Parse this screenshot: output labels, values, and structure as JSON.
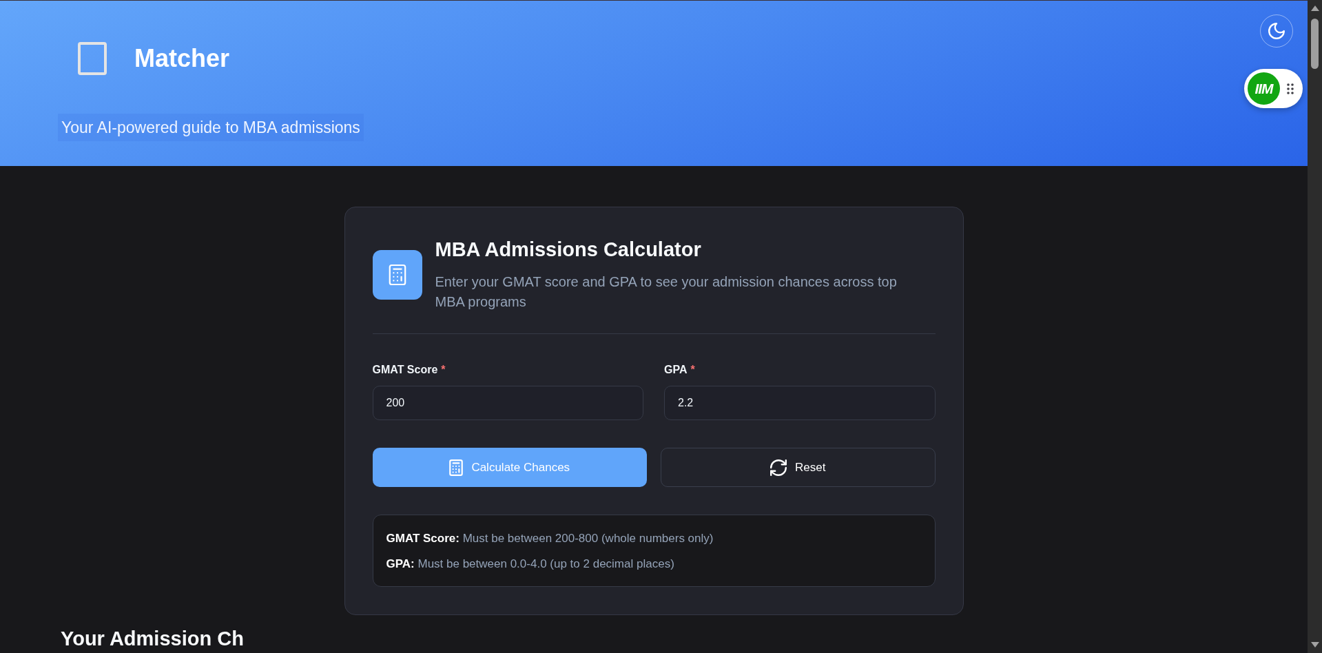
{
  "header": {
    "brand": "Matcher",
    "tagline": "Your AI-powered guide to MBA admissions"
  },
  "extension_badge": {
    "label": "IIM"
  },
  "calculator": {
    "title": "MBA Admissions Calculator",
    "description": "Enter your GMAT score and GPA to see your admission chances across top MBA programs",
    "fields": [
      {
        "label": "GMAT Score",
        "required_mark": "*",
        "value": "200"
      },
      {
        "label": "GPA",
        "required_mark": "*",
        "value": "2.2"
      }
    ],
    "buttons": [
      {
        "label": "Calculate Chances",
        "kind": "primary"
      },
      {
        "label": "Reset",
        "kind": "secondary"
      }
    ],
    "rules": [
      "**GMAT Score:** Must be between 200-800 (whole numbers only)",
      "**GPA:** Must be between 0.0-4.0 (up to 2 decimal places)"
    ]
  },
  "results": {
    "title": "Your Admission Ch"
  }
}
